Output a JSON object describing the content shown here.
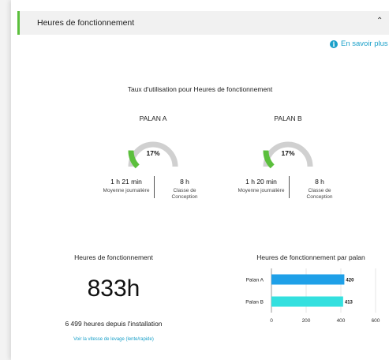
{
  "header": {
    "title": "Heures de fonctionnement",
    "chevron_icon": "chevron-up-icon"
  },
  "learn_more": {
    "label": "En savoir plus",
    "icon": "info-icon"
  },
  "utilization": {
    "title": "Taux d'utilisation pour Heures de fonctionnement",
    "hoists": [
      {
        "name": "PALAN A",
        "percent": 17,
        "percent_label": "17%",
        "avg_value": "1 h 21 min",
        "avg_label": "Moyenne journalière",
        "design_value": "8 h",
        "design_label": "Classe de Conception"
      },
      {
        "name": "PALAN B",
        "percent": 17,
        "percent_label": "17%",
        "avg_value": "1 h 20 min",
        "avg_label": "Moyenne journalière",
        "design_value": "8 h",
        "design_label": "Classe de Conception"
      }
    ]
  },
  "operating_hours": {
    "title": "Heures de fonctionnement",
    "total": "833h",
    "since_install": "6 499 heures depuis l'installation",
    "speed_link": "Voir la vitesse de levage (lente/rapide)"
  },
  "chart_data": {
    "type": "bar",
    "orientation": "horizontal",
    "title": "Heures de fonctionnement par palan",
    "categories": [
      "Palan A",
      "Palan B"
    ],
    "values": [
      420,
      413
    ],
    "value_labels": [
      "420",
      "413"
    ],
    "colors": [
      "#1fa0e8",
      "#34e0df"
    ],
    "xlim": [
      0,
      600
    ],
    "xticks": [
      "0",
      "200",
      "400",
      "600"
    ],
    "grid": true
  },
  "colors": {
    "accent_green": "#5bbf3c",
    "gauge_green": "#5bbf3c",
    "gauge_track": "#d0d0d0",
    "link_blue": "#1aa0c9"
  }
}
